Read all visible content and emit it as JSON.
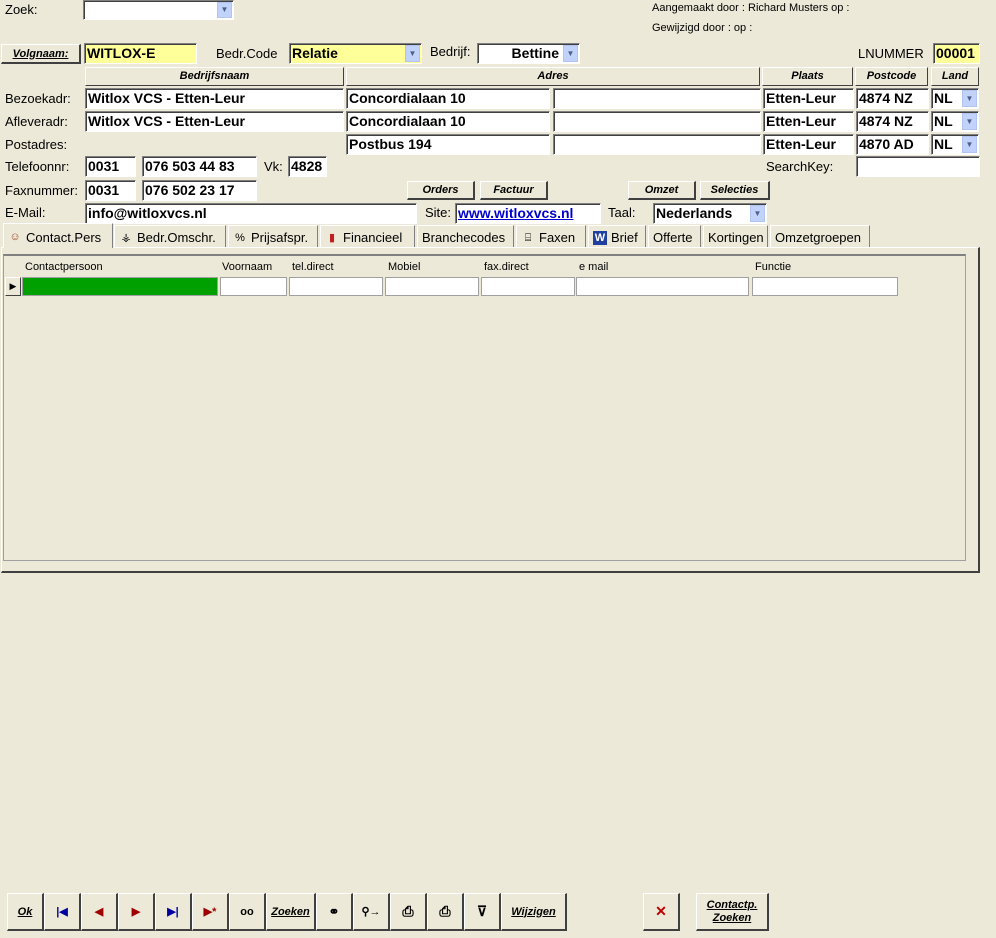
{
  "top": {
    "zoek_label": "Zoek:",
    "zoek_value": "",
    "aangemaakt": "Aangemaakt door : Richard Musters op :",
    "gewijzigd": "Gewijzigd door :   op :"
  },
  "row1": {
    "volgnaam_btn": "Volgnaam:",
    "volgnaam_value": "WITLOX-E",
    "bedrcode_label": "Bedr.Code",
    "bedrcode_value": "Relatie",
    "bedrijf_label": "Bedrijf:",
    "bedrijf_value": "Bettine",
    "lnummer_label": "LNUMMER",
    "lnummer_value": "00001"
  },
  "headers": {
    "bedrijfsnaam": "Bedrijfsnaam",
    "adres": "Adres",
    "plaats": "Plaats",
    "postcode": "Postcode",
    "land": "Land"
  },
  "addresses": [
    {
      "label": "Bezoekadr:",
      "naam": "Witlox VCS - Etten-Leur",
      "adres": "Concordialaan 10",
      "adres2": "",
      "plaats": "Etten-Leur",
      "postcode": "4874 NZ",
      "land": "NL"
    },
    {
      "label": "Afleveradr:",
      "naam": "Witlox VCS - Etten-Leur",
      "adres": "Concordialaan 10",
      "adres2": "",
      "plaats": "Etten-Leur",
      "postcode": "4874 NZ",
      "land": "NL"
    },
    {
      "label": "Postadres:",
      "naam": "",
      "adres": "Postbus 194",
      "adres2": "",
      "plaats": "Etten-Leur",
      "postcode": "4870 AD",
      "land": "NL"
    }
  ],
  "contact": {
    "tel_label": "Telefoonnr:",
    "tel_prefix": "0031",
    "tel_number": "076 503 44 83",
    "vk_label": "Vk:",
    "vk_value": "4828",
    "searchkey_label": "SearchKey:",
    "searchkey_value": "",
    "fax_label": "Faxnummer:",
    "fax_prefix": "0031",
    "fax_number": "076 502 23 17",
    "email_label": "E-Mail:",
    "email_value": "info@witloxvcs.nl",
    "site_label": "Site:",
    "site_value": "www.witloxvcs.nl",
    "taal_label": "Taal:",
    "taal_value": "Nederlands"
  },
  "action_buttons": {
    "orders": "Orders",
    "factuur": "Factuur",
    "omzet": "Omzet",
    "selecties": "Selecties"
  },
  "tabs": [
    {
      "label": "Contact.Pers",
      "icon": "contact-icon"
    },
    {
      "label": "Bedr.Omschr.",
      "icon": "org-chart-icon"
    },
    {
      "label": "Prijsafspr.",
      "icon": "percent-icon"
    },
    {
      "label": "Financieel",
      "icon": "finance-icon"
    },
    {
      "label": "Branchecodes",
      "icon": ""
    },
    {
      "label": "Faxen",
      "icon": "fax-icon"
    },
    {
      "label": "Brief",
      "icon": "word-icon"
    },
    {
      "label": "Offerte",
      "icon": ""
    },
    {
      "label": "Kortingen",
      "icon": ""
    },
    {
      "label": "Omzetgroepen",
      "icon": ""
    }
  ],
  "grid": {
    "columns": [
      "Contactpersoon",
      "Voornaam",
      "tel.direct",
      "Mobiel",
      "fax.direct",
      "e mail",
      "Functie"
    ]
  },
  "bottom": {
    "ok": "Ok",
    "zoeken": "Zoeken",
    "wijzigen": "Wijzigen",
    "contactp_zoeken_1": "Contactp.",
    "contactp_zoeken_2": "Zoeken"
  },
  "colors": {
    "background": "#ece9d8",
    "highlight_yellow": "#ffff99",
    "selected_green": "#00a000",
    "link_blue": "#0000cc"
  }
}
